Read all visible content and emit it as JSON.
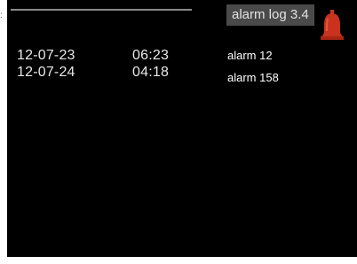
{
  "header": {
    "title": "alarm log 3.4",
    "icon": "bell-icon",
    "icon_color": "#c8321e"
  },
  "alarm_log": {
    "rows": [
      {
        "date": "12-07-23",
        "time": "06:23",
        "message": "alarm 12"
      },
      {
        "date": "12-07-24",
        "time": "04:18",
        "message": "alarm 158"
      }
    ]
  },
  "colors": {
    "screen_background": "#000000",
    "title_background": "#4a4a4a",
    "text": "#ffffff"
  }
}
